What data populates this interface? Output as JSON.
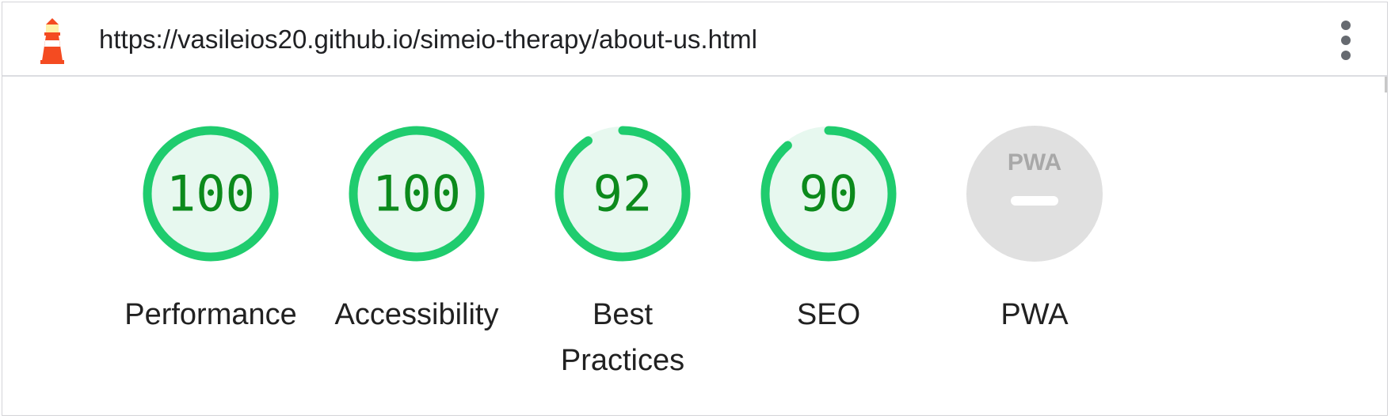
{
  "header": {
    "url": "https://vasileios20.github.io/simeio-therapy/about-us.html",
    "logo_icon": "lighthouse-icon",
    "menu_icon": "more-vert-icon"
  },
  "colors": {
    "pass_arc": "#1fcc6e",
    "pass_fill": "#e7f8ef",
    "pass_text": "#0c8a1c",
    "pwa_fill": "#e0e0e0",
    "pwa_mark": "#a8a8a8"
  },
  "gauges": [
    {
      "label_lines": [
        "Performance"
      ],
      "score": 100
    },
    {
      "label_lines": [
        "Accessibility"
      ],
      "score": 100
    },
    {
      "label_lines": [
        "Best",
        "Practices"
      ],
      "score": 92
    },
    {
      "label_lines": [
        "SEO"
      ],
      "score": 90
    },
    {
      "label_lines": [
        "PWA"
      ],
      "score": null,
      "badge_text": "PWA",
      "badge_icon": "pwa-badge-icon"
    }
  ]
}
